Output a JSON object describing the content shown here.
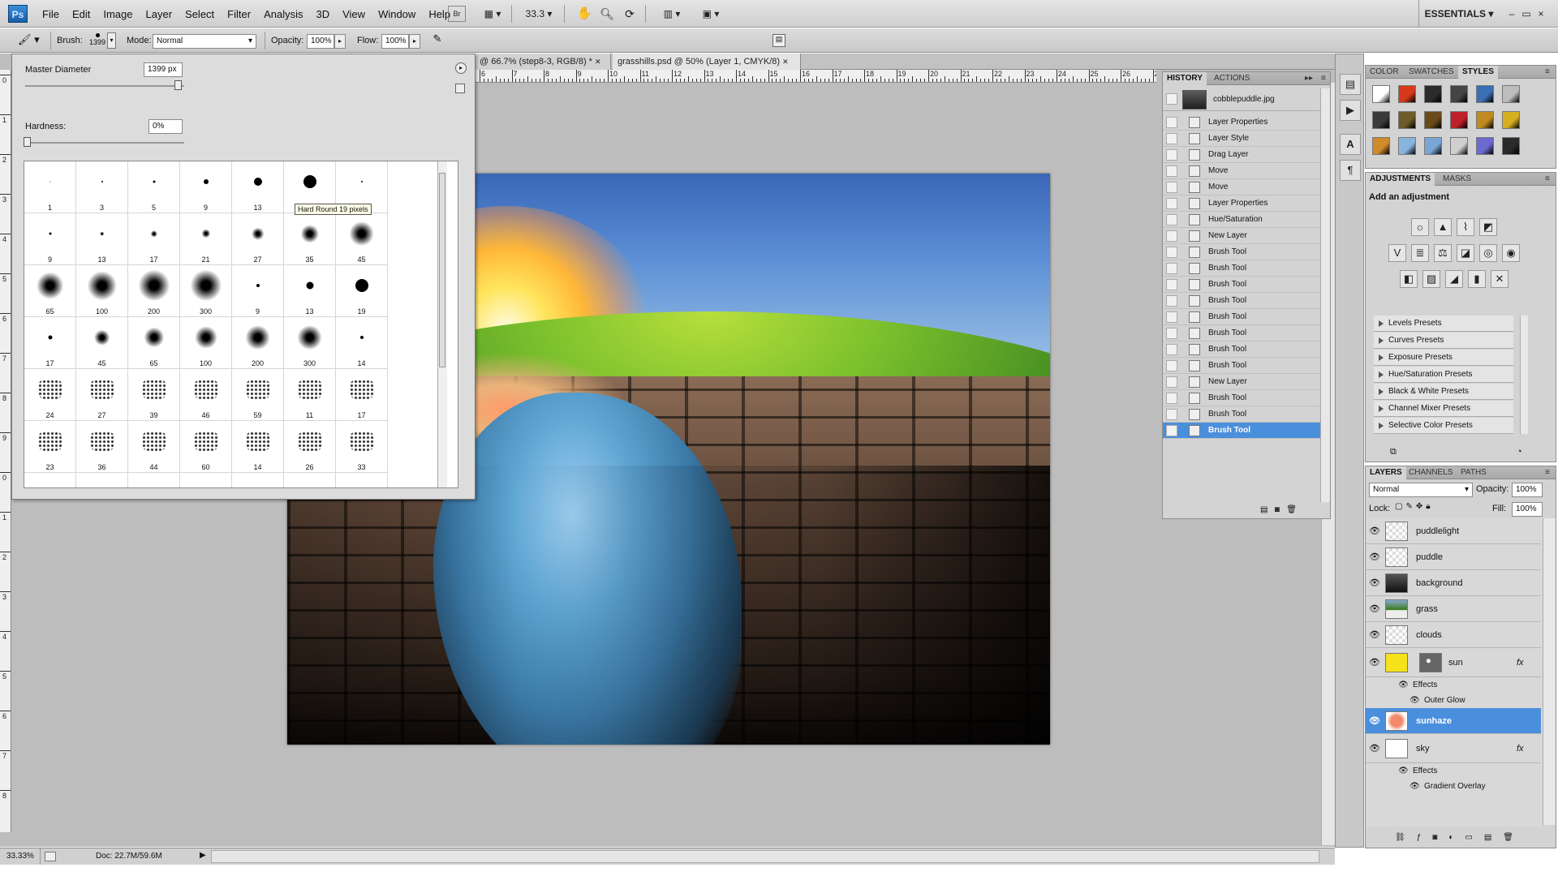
{
  "app": {
    "logo": "Ps"
  },
  "menu": [
    "File",
    "Edit",
    "Image",
    "Layer",
    "Select",
    "Filter",
    "Analysis",
    "3D",
    "View",
    "Window",
    "Help"
  ],
  "appbar": {
    "zoom_value": "33.3",
    "workspace": "ESSENTIALS",
    "win_controls": [
      "–",
      "▭",
      "×"
    ]
  },
  "options": {
    "brush_label": "Brush:",
    "brush_size": "1399",
    "mode_label": "Mode:",
    "mode_value": "Normal",
    "opacity_label": "Opacity:",
    "opacity_value": "100%",
    "flow_label": "Flow:",
    "flow_value": "100%"
  },
  "doc_tabs": [
    "@ 66.7% (step8-3, RGB/8) *",
    "grasshills.psd @ 50% (Layer 1, CMYK/8)"
  ],
  "ruler_h": [
    "6",
    "7",
    "8",
    "9",
    "10",
    "11",
    "12",
    "13",
    "14",
    "15",
    "16",
    "17",
    "18",
    "19",
    "20",
    "21",
    "22",
    "23",
    "24",
    "25",
    "26",
    "27"
  ],
  "ruler_v": [
    "0",
    "1",
    "2",
    "3",
    "4",
    "5",
    "6",
    "7",
    "8",
    "9",
    "0",
    "1",
    "2",
    "3",
    "4",
    "5",
    "6",
    "7",
    "8"
  ],
  "brush_picker": {
    "master_label": "Master Diameter",
    "master_value": "1399 px",
    "hardness_label": "Hardness:",
    "hardness_value": "0%",
    "tooltip": "Hard Round 19 pixels",
    "rows": [
      [
        "1",
        "3",
        "5",
        "9",
        "13",
        "",
        ""
      ],
      [
        "9",
        "13",
        "17",
        "21",
        "27",
        "35",
        "45"
      ],
      [
        "65",
        "100",
        "200",
        "300",
        "9",
        "13",
        "19"
      ],
      [
        "17",
        "45",
        "65",
        "100",
        "200",
        "300",
        "14"
      ],
      [
        "24",
        "27",
        "39",
        "46",
        "59",
        "11",
        "17"
      ],
      [
        "23",
        "36",
        "44",
        "60",
        "14",
        "26",
        "33"
      ]
    ]
  },
  "history": {
    "tabs": [
      "HISTORY",
      "ACTIONS"
    ],
    "snapshot": "cobblepuddle.jpg",
    "items": [
      "Layer Properties",
      "Layer Style",
      "Drag Layer",
      "Move",
      "Move",
      "Layer Properties",
      "Hue/Saturation",
      "New Layer",
      "Brush Tool",
      "Brush Tool",
      "Brush Tool",
      "Brush Tool",
      "Brush Tool",
      "Brush Tool",
      "Brush Tool",
      "Brush Tool",
      "New Layer",
      "Brush Tool",
      "Brush Tool",
      "Brush Tool"
    ],
    "selected_index": 19
  },
  "styles": {
    "tabs": [
      "COLOR",
      "SWATCHES",
      "STYLES"
    ]
  },
  "adjustments": {
    "tabs": [
      "ADJUSTMENTS",
      "MASKS"
    ],
    "title": "Add an adjustment",
    "presets": [
      "Levels Presets",
      "Curves Presets",
      "Exposure Presets",
      "Hue/Saturation Presets",
      "Black & White Presets",
      "Channel Mixer Presets",
      "Selective Color Presets"
    ]
  },
  "layers": {
    "tabs": [
      "LAYERS",
      "CHANNELS",
      "PATHS"
    ],
    "blend_mode": "Normal",
    "opacity_label": "Opacity:",
    "opacity_value": "100%",
    "lock_label": "Lock:",
    "fill_label": "Fill:",
    "fill_value": "100%",
    "items": [
      "puddlelight",
      "puddle",
      "background",
      "grass",
      "clouds",
      "sun",
      "sunhaze",
      "sky"
    ],
    "sun_effects_label": "Effects",
    "sun_effect": "Outer Glow",
    "sky_effects_label": "Effects",
    "sky_effect": "Gradient Overlay",
    "fx": "fx"
  },
  "status": {
    "zoom": "33.33%",
    "doc": "Doc: 22.7M/59.6M"
  }
}
